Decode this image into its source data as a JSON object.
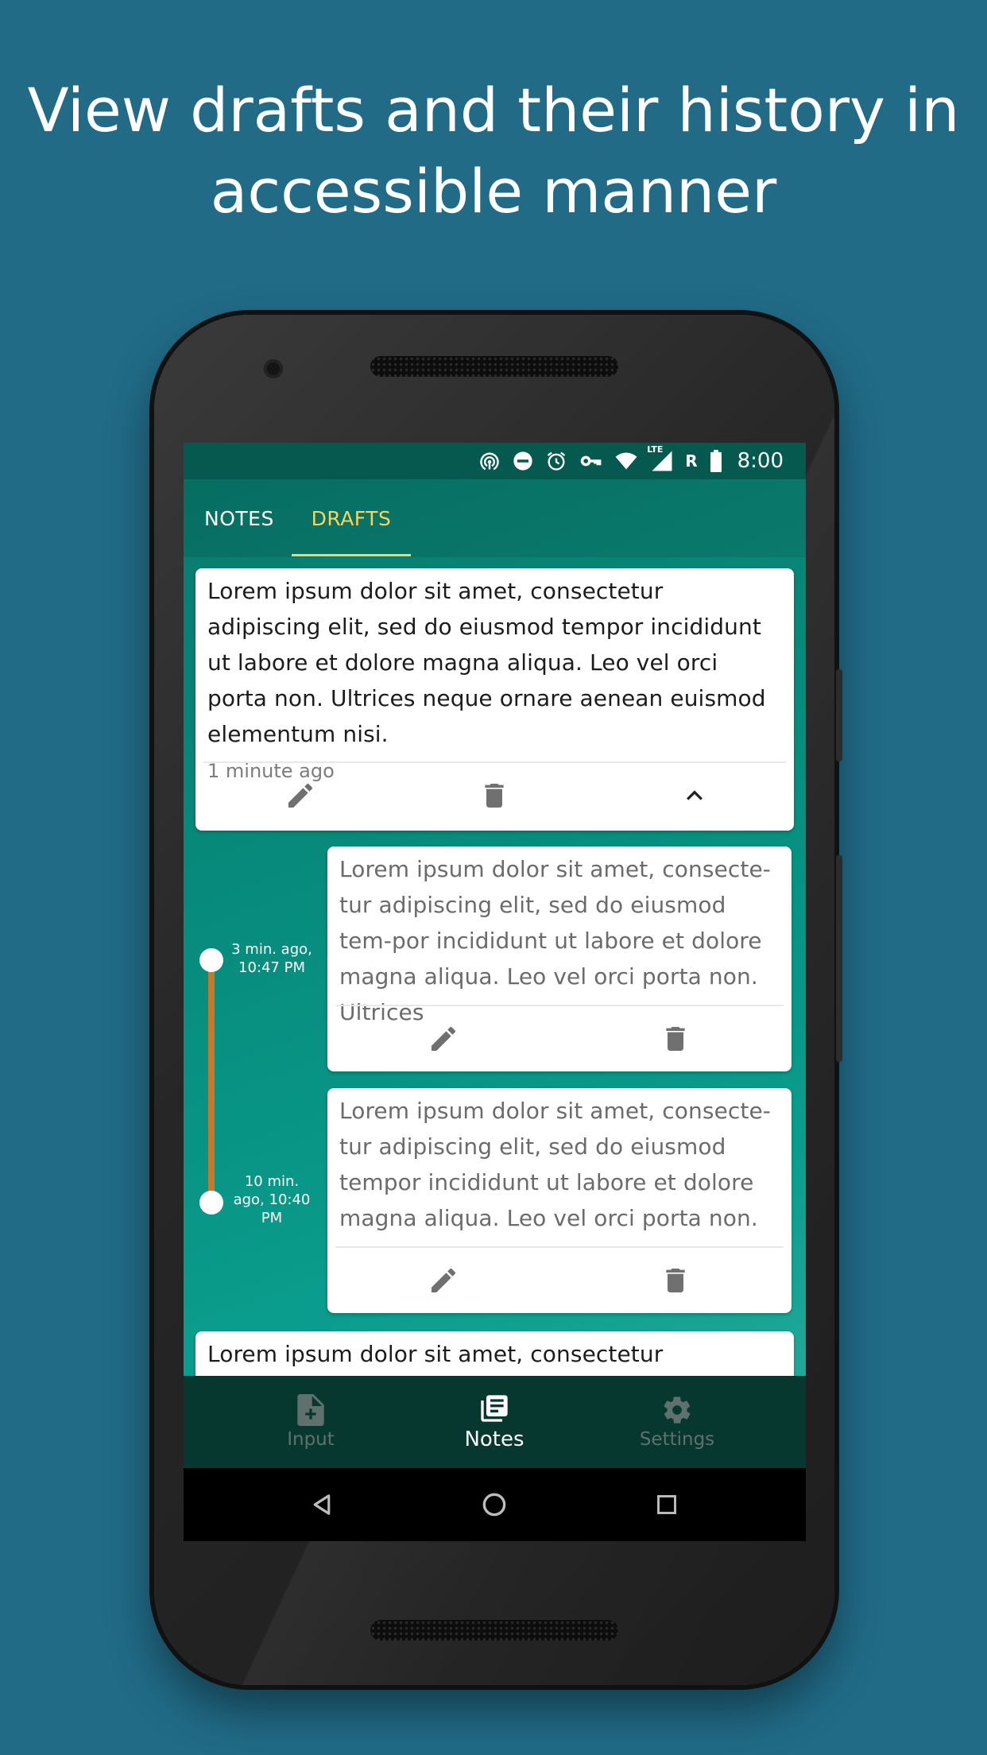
{
  "headline": {
    "line1": "View drafts and their history in",
    "line2": "accessible manner"
  },
  "status_bar": {
    "icons": [
      "hotspot-icon",
      "do-not-disturb-icon",
      "alarm-icon",
      "vpn-key-icon",
      "wifi-icon",
      "lte-signal-icon",
      "battery-icon"
    ],
    "network_lte": "LTE",
    "roaming": "R",
    "time": "8:00"
  },
  "tabs": [
    {
      "label": "NOTES",
      "selected": false
    },
    {
      "label": "DRAFTS",
      "selected": true
    }
  ],
  "drafts": {
    "main": {
      "text": "Lorem ipsum dolor sit amet, consectetur adipiscing elit, sed do eiusmod tempor incididunt ut labore et dolore magna aliqua. Leo vel orci porta non. Ultrices neque ornare aenean euismod elementum nisi.",
      "time": "1 minute ago"
    },
    "history": [
      {
        "timestamp": "3 min. ago, 10:47 PM",
        "text": "Lorem ipsum dolor sit amet, consecte-tur adipiscing elit, sed do eiusmod tem-por incididunt ut labore et dolore magna aliqua. Leo vel orci porta non. Ultrices"
      },
      {
        "timestamp": "10 min. ago, 10:40 PM",
        "text": "Lorem ipsum dolor sit amet, consecte-tur adipiscing elit, sed do eiusmod tempor incididunt ut labore et dolore magna aliqua. Leo vel orci porta non."
      }
    ],
    "next_peek": "Lorem ipsum dolor sit amet, consectetur adipiscing"
  },
  "bottom_nav": [
    {
      "label": "Input",
      "icon": "note-add-icon",
      "selected": false
    },
    {
      "label": "Notes",
      "icon": "notes-icon",
      "selected": true
    },
    {
      "label": "Settings",
      "icon": "gear-icon",
      "selected": false
    }
  ],
  "colors": {
    "background": "#216b87",
    "accent_tab": "#f6d55c",
    "timeline": "#c8782a",
    "bottom_nav": "#06382f"
  }
}
